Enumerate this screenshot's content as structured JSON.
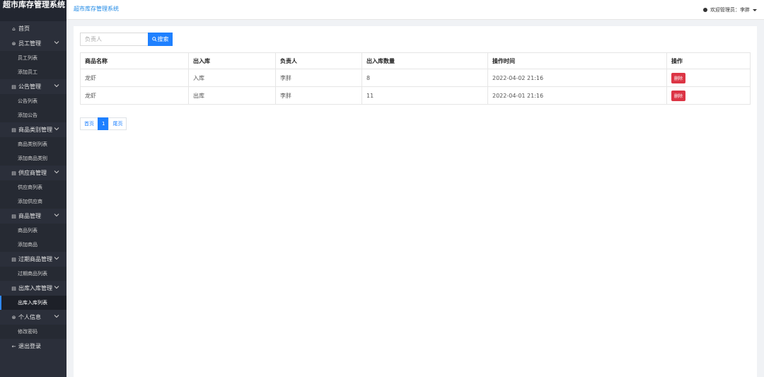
{
  "app": {
    "title": "超市库存管理系统"
  },
  "breadcrumb": "超市库存管理系统",
  "user": {
    "greeting": "欢迎管理员：李胖"
  },
  "sidebar": {
    "home": "首页",
    "groups": [
      {
        "label": "员工管理",
        "items": [
          "员工列表",
          "添加员工"
        ]
      },
      {
        "label": "公告管理",
        "items": [
          "公告列表",
          "添加公告"
        ]
      },
      {
        "label": "商品类别管理",
        "items": [
          "商品类别列表",
          "添加商品类别"
        ]
      },
      {
        "label": "供应商管理",
        "items": [
          "供应商列表",
          "添加供应商"
        ]
      },
      {
        "label": "商品管理",
        "items": [
          "商品列表",
          "添加商品"
        ]
      },
      {
        "label": "过期商品管理",
        "items": [
          "过期商品列表"
        ]
      },
      {
        "label": "出库入库管理",
        "items": [
          "出库入库列表"
        ]
      },
      {
        "label": "个人信息",
        "items": [
          "修改密码"
        ]
      }
    ],
    "logout": "退出登录"
  },
  "search": {
    "placeholder": "负责人",
    "button": "搜索"
  },
  "table": {
    "headers": [
      "商品名称",
      "出入库",
      "负责人",
      "出入库数量",
      "操作时间",
      "操作"
    ],
    "rows": [
      [
        "龙虾",
        "入库",
        "李胖",
        "8",
        "2022-04-02 21:16",
        "删除"
      ],
      [
        "龙虾",
        "出库",
        "李胖",
        "11",
        "2022-04-01 21:16",
        "删除"
      ]
    ]
  },
  "pagination": {
    "first": "首页",
    "current": "1",
    "last": "尾页"
  },
  "colors": {
    "primary": "#1e80ff",
    "danger": "#dc3545",
    "sidebar": "#2b2f3a"
  }
}
